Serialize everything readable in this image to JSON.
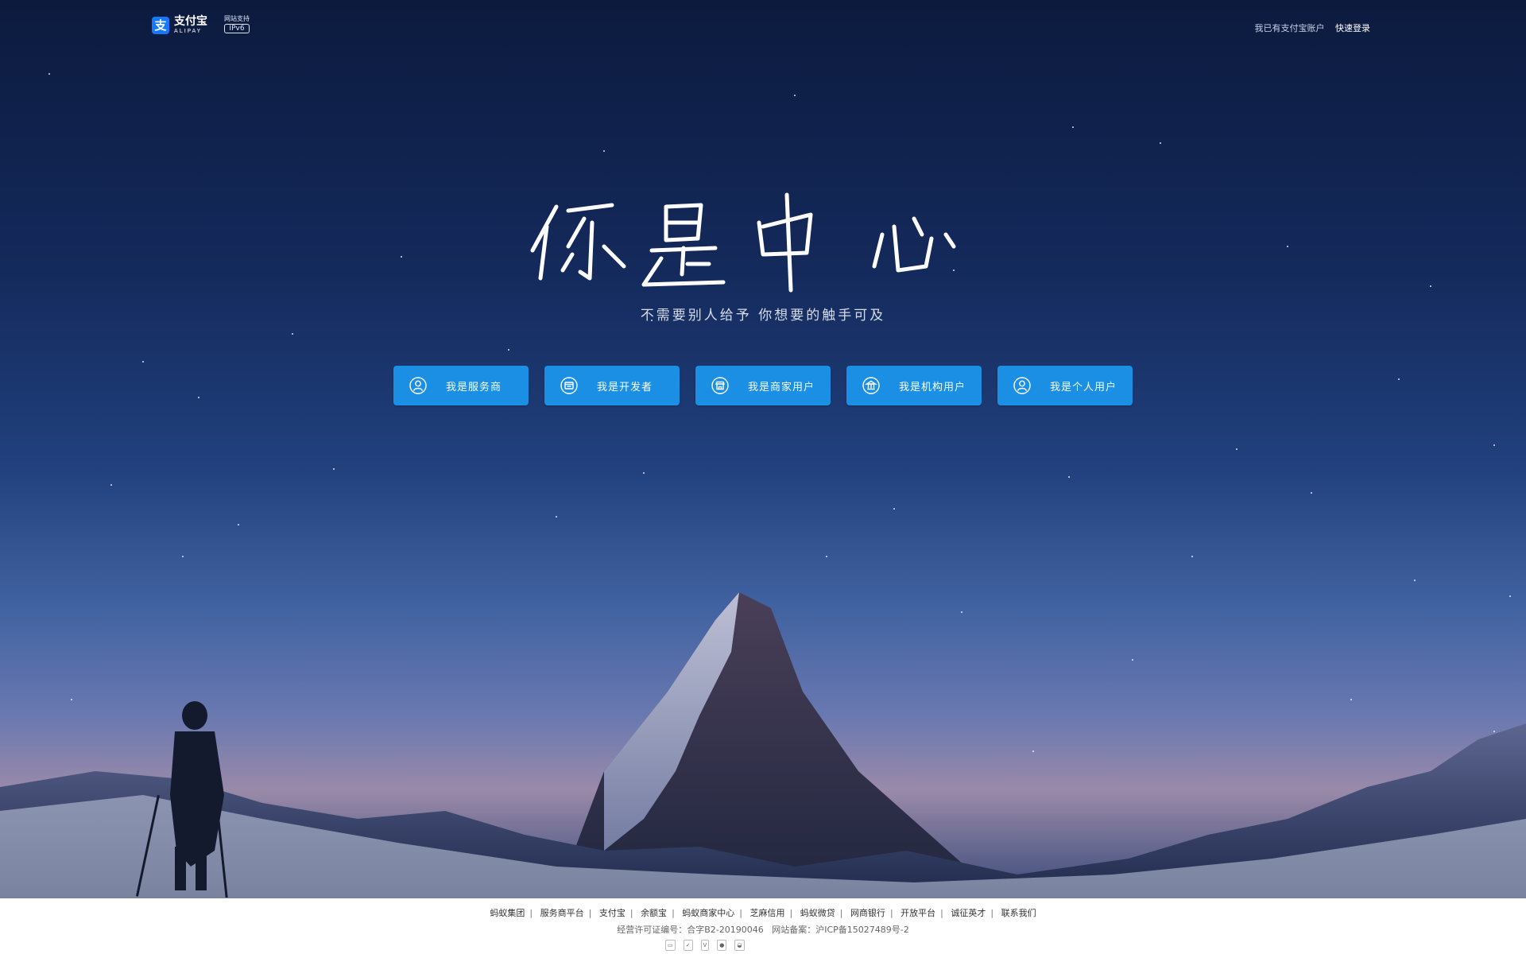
{
  "header": {
    "logo_cn": "支付宝",
    "logo_en": "ALIPAY",
    "ipv6_top": "网站支持",
    "ipv6_tag": "IPv6",
    "account_prompt": "我已有支付宝账户",
    "login_link": "快速登录"
  },
  "hero": {
    "slogan": "你是中心",
    "subtitle": "不需要别人给予 你想要的触手可及",
    "roles": [
      {
        "label": "我是服务商",
        "icon": "user-circle-icon"
      },
      {
        "label": "我是开发者",
        "icon": "developer-window-icon"
      },
      {
        "label": "我是商家用户",
        "icon": "shop-icon"
      },
      {
        "label": "我是机构用户",
        "icon": "institution-icon"
      },
      {
        "label": "我是个人用户",
        "icon": "person-circle-icon"
      }
    ]
  },
  "footer": {
    "links": [
      "蚂蚁集团",
      "服务商平台",
      "支付宝",
      "余额宝",
      "蚂蚁商家中心",
      "芝麻信用",
      "蚂蚁微贷",
      "网商银行",
      "开放平台",
      "诚征英才",
      "联系我们"
    ],
    "license": "经营许可证编号：合字B2-20190046",
    "icp": "网站备案：沪ICP备15027489号-2",
    "badges": [
      "trust-badge",
      "verisign-badge",
      "verified-by-visa-badge",
      "police-badge",
      "cert-badge"
    ]
  },
  "colors": {
    "brand_blue": "#1677ff",
    "role_button": "#1a8fe3"
  }
}
